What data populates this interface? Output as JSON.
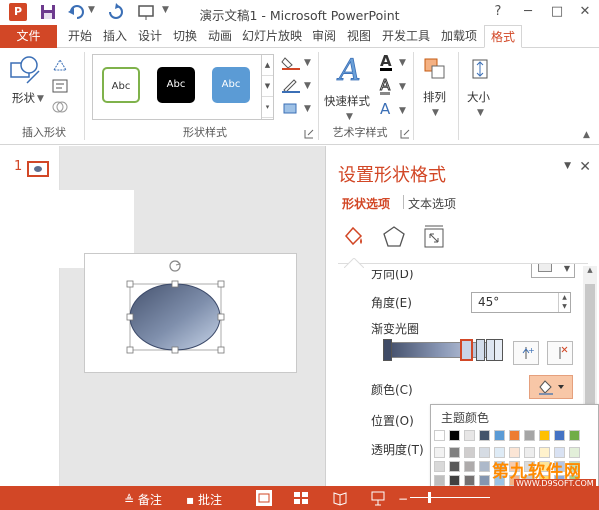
{
  "window": {
    "title": "演示文稿1 - Microsoft PowerPoint",
    "help": "?",
    "minimize": "─",
    "maximize": "□",
    "close": "✕"
  },
  "app_icon_label": "P",
  "tabs": [
    {
      "label": "文件"
    },
    {
      "label": "开始"
    },
    {
      "label": "插入"
    },
    {
      "label": "设计"
    },
    {
      "label": "切换"
    },
    {
      "label": "动画"
    },
    {
      "label": "幻灯片放映"
    },
    {
      "label": "审阅"
    },
    {
      "label": "视图"
    },
    {
      "label": "开发工具"
    },
    {
      "label": "加载项"
    },
    {
      "label": "格式"
    }
  ],
  "ribbon": {
    "insert_shapes": {
      "shapes_label": "形状",
      "group_label": "插入形状"
    },
    "shape_styles": {
      "samples": [
        "Abc",
        "Abc",
        "Abc"
      ],
      "group_label": "形状样式"
    },
    "wordart": {
      "quick_styles_label": "快速样式",
      "letter_a": "A",
      "group_label": "艺术字样式"
    },
    "arrange": {
      "label": "排列"
    },
    "size": {
      "label": "大小"
    }
  },
  "thumbnails": {
    "slide_number": "1"
  },
  "pane": {
    "title": "设置形状格式",
    "tab_shape": "形状选项",
    "tab_text": "文本选项",
    "direction_label": "方向(D)",
    "angle_label": "角度(E)",
    "angle_value": "45°",
    "gradient_stops_label": "渐变光圈",
    "color_label": "颜色(C)",
    "position_label": "位置(O)",
    "transparency_label": "透明度(T)"
  },
  "color_dropdown": {
    "title": "主题颜色",
    "theme_row": [
      "#ffffff",
      "#000000",
      "#e7e6e6",
      "#44546a",
      "#5b9bd5",
      "#ed7d31",
      "#a5a5a5",
      "#ffc000",
      "#4472c4",
      "#70ad47"
    ],
    "shade_rows": [
      [
        "#f2f2f2",
        "#808080",
        "#d0cece",
        "#d6dce4",
        "#deebf6",
        "#fbe5d5",
        "#ededed",
        "#fff2cc",
        "#d9e2f3",
        "#e2efd9"
      ],
      [
        "#d9d9d9",
        "#595959",
        "#aeabab",
        "#adb9ca",
        "#bdd7ee",
        "#f7cbac",
        "#dbdbdb",
        "#fee599",
        "#b4c6e7",
        "#c5e0b3"
      ],
      [
        "#bfbfbf",
        "#404040",
        "#757171",
        "#8496b0",
        "#9cc3e5",
        "#f4b183",
        "#c9c9c9",
        "#ffd965",
        "#8eaadb",
        "#a8d08d"
      ],
      [
        "#a6a6a6",
        "#262626",
        "#3a3838",
        "#323f4f",
        "#2e75b5",
        "#c55a11",
        "#7b7b7b",
        "#bf9000",
        "#2f5496",
        "#538135"
      ]
    ]
  },
  "status_bar": {
    "notes_label": "备注",
    "comments_label": "批注"
  },
  "watermark": {
    "main": "第九软件网",
    "sub": "WWW.D9SOFT.COM"
  },
  "colors": {
    "accent": "#d24726"
  }
}
